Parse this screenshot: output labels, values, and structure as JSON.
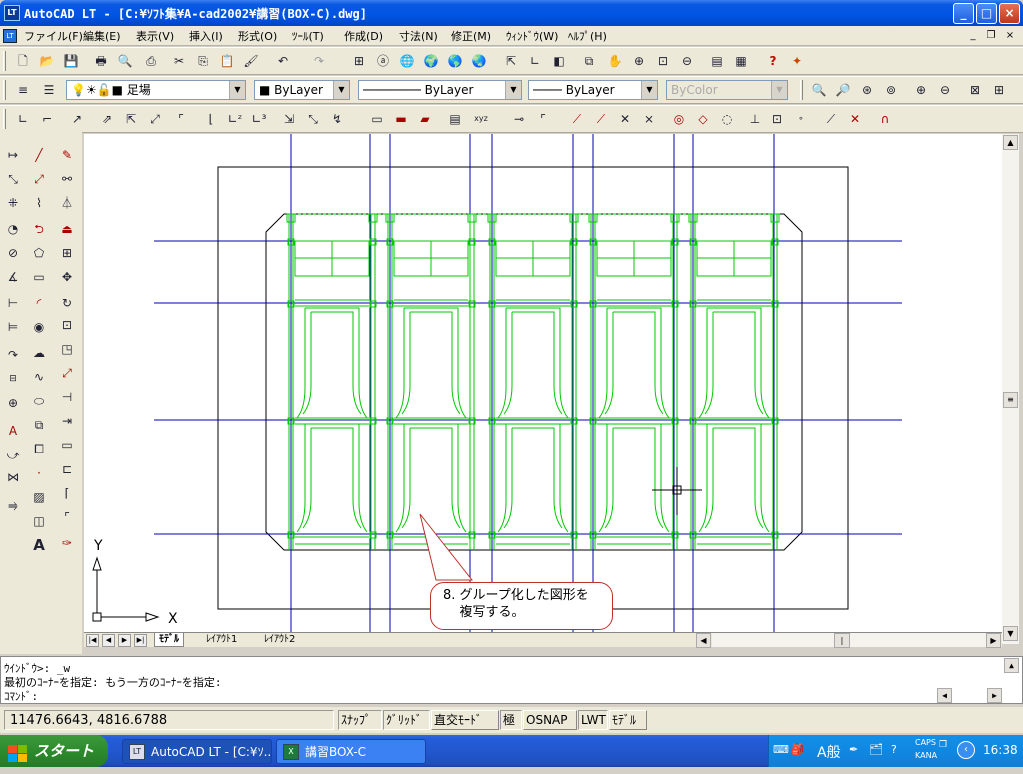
{
  "window": {
    "app_icon": "LT",
    "title": "AutoCAD LT - [C:¥ｿﾌﾄ集¥A-cad2002¥講習(BOX-C).dwg]",
    "controls": {
      "minimize": "_",
      "maximize": "□",
      "close": "×"
    }
  },
  "menubar": {
    "items": [
      "ファイル(F)",
      "編集(E)",
      "表示(V)",
      "挿入(I)",
      "形式(O)",
      "ﾂｰﾙ(T)",
      "作成(D)",
      "寸法(N)",
      "修正(M)",
      "ｳｨﾝﾄﾞｳ(W)",
      "ﾍﾙﾌﾟ(H)"
    ],
    "doc_controls": [
      "_",
      "❐",
      "×"
    ]
  },
  "layer_toolbar": {
    "current_layer": "足場",
    "color": "ByLayer",
    "linetype": "ByLayer",
    "lineweight": "ByLayer",
    "plotstyle": "ByColor"
  },
  "tabs": {
    "items": [
      "ﾓﾃﾞﾙ",
      "ﾚｲｱｳﾄ1",
      "ﾚｲｱｳﾄ2"
    ],
    "active": "ﾓﾃﾞﾙ"
  },
  "ucs": {
    "x_label": "X",
    "y_label": "Y"
  },
  "callout": {
    "text": "8. グループ化した図形を\n    複写する。"
  },
  "command_window": {
    "lines": [
      "ｳｲﾝﾄﾞｳ>:  _w",
      "最初のｺｰﾅｰを指定: もう一方のｺｰﾅｰを指定:",
      "ｺﾏﾝﾄﾞ:"
    ]
  },
  "statusbar": {
    "coordinates": "11476.6643, 4816.6788",
    "toggles": [
      {
        "label": "ｽﾅｯﾌﾟ",
        "on": false
      },
      {
        "label": "ｸﾞﾘｯﾄﾞ",
        "on": false
      },
      {
        "label": "直交ﾓｰﾄﾞ",
        "on": true
      },
      {
        "label": "極",
        "on": false
      },
      {
        "label": "OSNAP",
        "on": true
      },
      {
        "label": "LWT",
        "on": false
      },
      {
        "label": "ﾓﾃﾞﾙ",
        "on": true
      }
    ]
  },
  "taskbar": {
    "start_label": "スタート",
    "tasks": [
      {
        "label": "AutoCAD LT - [C:¥ｿ...",
        "icon": "LT",
        "active": true
      },
      {
        "label": "講習BOX-C",
        "icon": "X",
        "active": false
      }
    ],
    "ime": "A般",
    "caps": "CAPS",
    "kana": "KANA",
    "clock": "16:38"
  },
  "colors": {
    "drawing_green": "#00c800",
    "grid_blue": "#0000b4",
    "callout_border": "#c0302a",
    "xp_blue": "#0054e3"
  }
}
